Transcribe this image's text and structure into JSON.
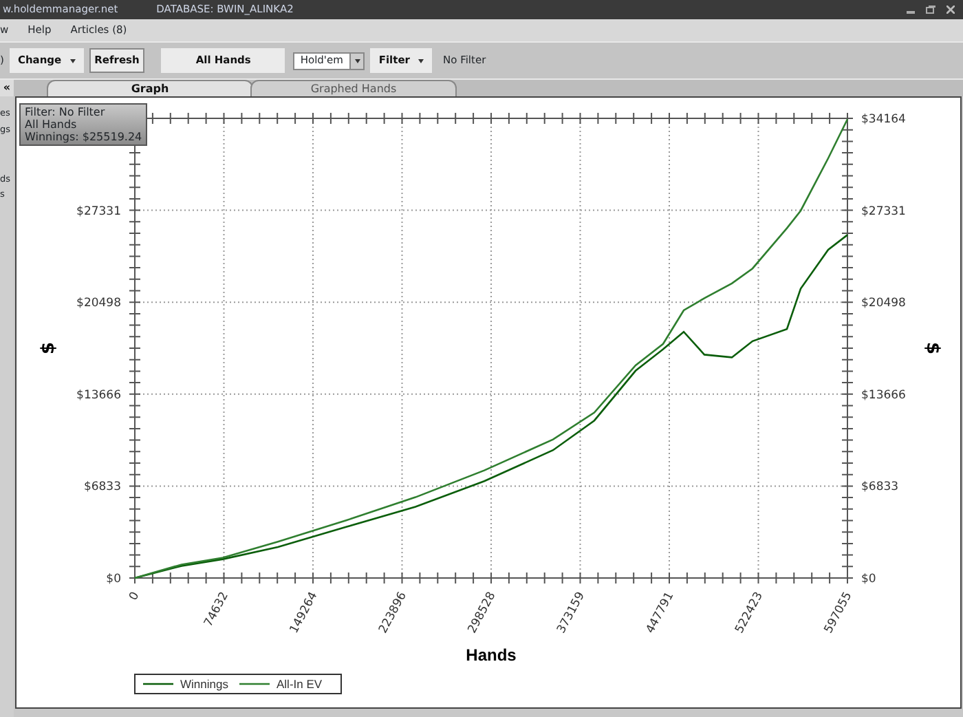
{
  "window": {
    "site": "w.holdemmanager.net",
    "database": "DATABASE: BWIN_ALINKA2"
  },
  "menu": [
    {
      "label": "w"
    },
    {
      "label": "Help"
    },
    {
      "label": "Articles (8)"
    }
  ],
  "toolbar": {
    "cut_label": ")",
    "change": "Change",
    "refresh": "Refresh",
    "all_hands": "All Hands",
    "game": "Hold'em",
    "filter": "Filter",
    "filter_value": "No Filter"
  },
  "collapse_button": "«",
  "tabs": [
    {
      "label": "Graph",
      "selected": true
    },
    {
      "label": "Graphed Hands",
      "selected": false
    }
  ],
  "sidebar": [
    "es",
    "gs",
    "ds",
    "s"
  ],
  "info_box": [
    "Filter: No Filter",
    "All Hands",
    "Winnings: $25519.24"
  ],
  "chart": {
    "right_ylabel": "$",
    "right_ytick_labels": [
      "$34164",
      "$27331",
      "$20498",
      "$13666",
      "$6833",
      "$0"
    ],
    "chart_data": {
      "type": "line",
      "grid": true,
      "legend": true,
      "xlabel": "Hands",
      "ylabel": "$",
      "xlim": [
        0,
        597055
      ],
      "ylim": [
        0,
        34164
      ],
      "xticks": [
        0,
        74632,
        149264,
        223896,
        298528,
        373159,
        447791,
        522423,
        597055
      ],
      "yticks": [
        {
          "value": 0,
          "label": "$0"
        },
        {
          "value": 6833,
          "label": "$6833"
        },
        {
          "value": 13666,
          "label": "$13666"
        },
        {
          "value": 20498,
          "label": "$20498"
        },
        {
          "value": 27331,
          "label": "$27331"
        }
      ],
      "x": [
        0,
        39190,
        73770,
        119870,
        177500,
        235130,
        292760,
        350390,
        384970,
        419550,
        442600,
        459890,
        477180,
        500230,
        517520,
        546340,
        557860,
        580910,
        597055
      ],
      "series": [
        {
          "name": "Winnings",
          "color": "#0b5e0b",
          "values": [
            0,
            900,
            1400,
            2300,
            3800,
            5300,
            7200,
            9500,
            11700,
            15400,
            17000,
            18300,
            16600,
            16400,
            17600,
            18500,
            21500,
            24400,
            25500
          ]
        },
        {
          "name": "All-In EV",
          "color": "#2f7f2f",
          "values": [
            0,
            1000,
            1500,
            2700,
            4300,
            6000,
            8000,
            10300,
            12300,
            15800,
            17400,
            19900,
            20800,
            21900,
            23000,
            26000,
            27300,
            31200,
            34100
          ]
        }
      ]
    }
  }
}
